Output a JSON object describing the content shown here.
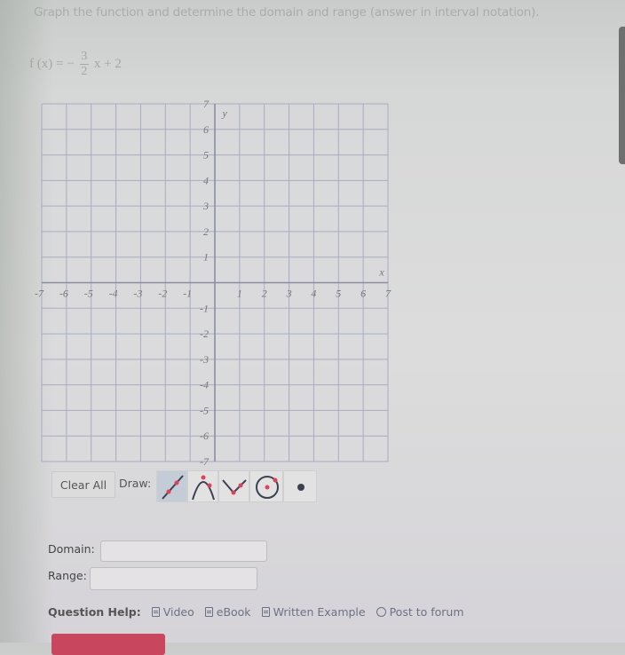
{
  "instruction": "Graph the function and determine the domain and range (answer in interval notation).",
  "formula": {
    "lhs": "f (x) =",
    "sign": "−",
    "numerator": "3",
    "denominator": "2",
    "rest": "x + 2"
  },
  "graph": {
    "x_axis_label": "x",
    "y_axis_label": "y",
    "x_range": [
      -7,
      7
    ],
    "y_range": [
      -7,
      7
    ],
    "x_ticks": [
      "-7",
      "-6",
      "-5",
      "-4",
      "-3",
      "-2",
      "-1",
      "1",
      "2",
      "3",
      "4",
      "5",
      "6",
      "7"
    ],
    "y_ticks": [
      "7",
      "6",
      "5",
      "4",
      "3",
      "2",
      "1",
      "-1",
      "-2",
      "-3",
      "-4",
      "-5",
      "-6",
      "-7"
    ],
    "grid": true,
    "colors": {
      "grid": "#a9acbf",
      "axis": "#8a8ca6",
      "tick_label": "#777777",
      "accent": "#e0405a",
      "ink": "#3b4150"
    }
  },
  "toolbar": {
    "clear_label": "Clear All",
    "draw_label": "Draw:",
    "tools": [
      {
        "name": "line",
        "selected": true
      },
      {
        "name": "parabola",
        "selected": false
      },
      {
        "name": "absolute-value",
        "selected": false
      },
      {
        "name": "circle",
        "selected": false
      },
      {
        "name": "point",
        "selected": false
      }
    ]
  },
  "answers": {
    "domain_label": "Domain:",
    "domain_value": "",
    "range_label": "Range:",
    "range_value": ""
  },
  "help": {
    "title": "Question Help:",
    "links": [
      {
        "label": "Video",
        "icon": "document-icon"
      },
      {
        "label": "eBook",
        "icon": "document-icon"
      },
      {
        "label": "Written Example",
        "icon": "document-icon"
      },
      {
        "label": "Post to forum",
        "icon": "chat-icon"
      }
    ]
  }
}
